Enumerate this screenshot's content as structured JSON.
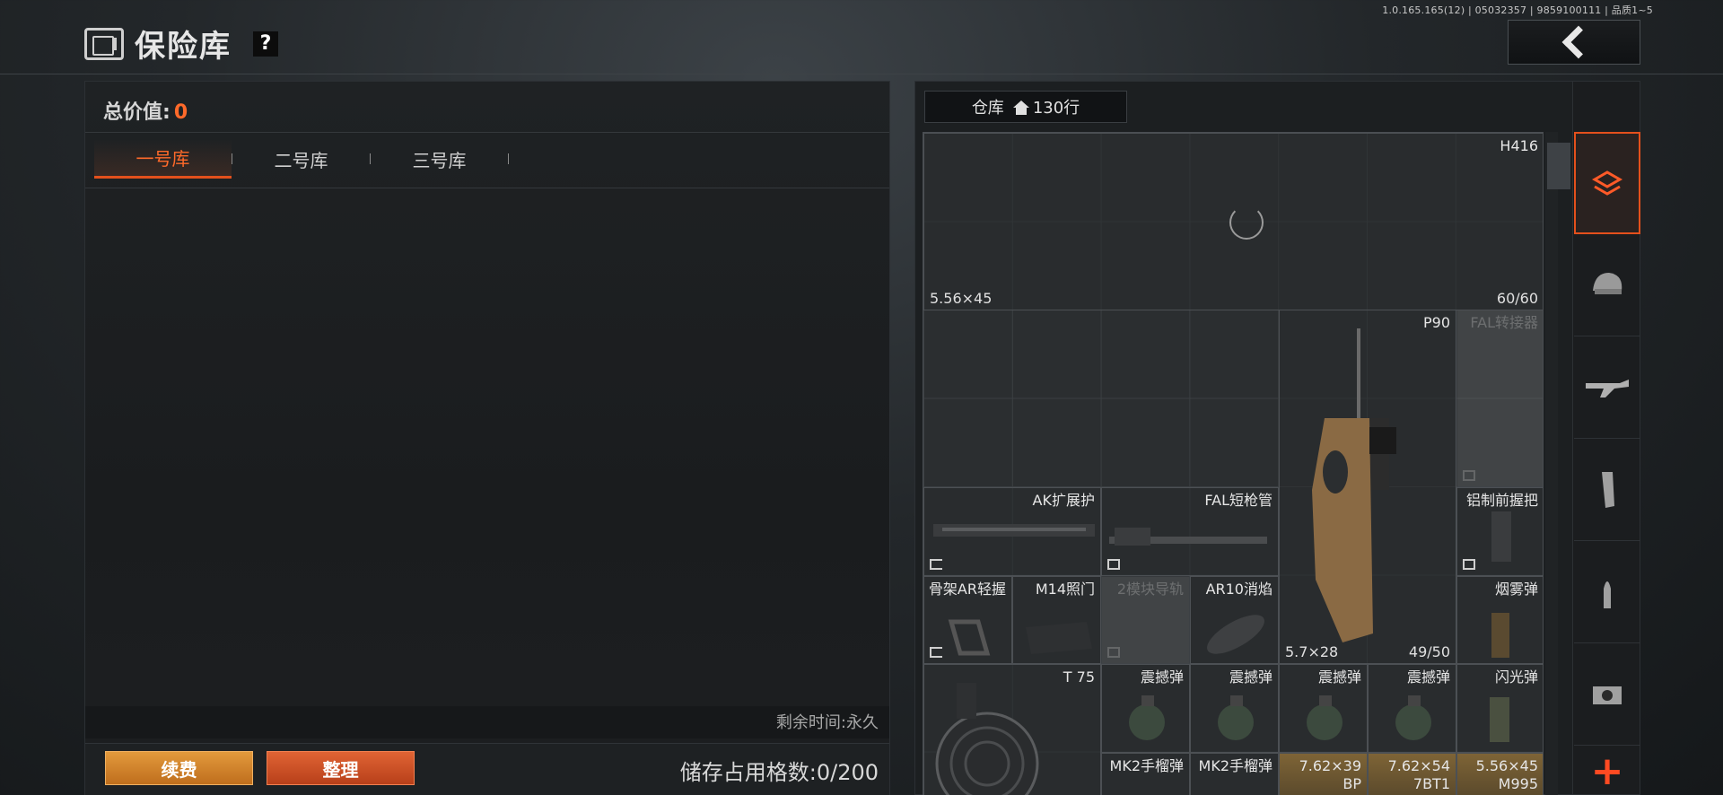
{
  "build_info": "1.0.165.165(12) | 05032357 | 9859100111 | 品质1~5",
  "header": {
    "title": "保险库",
    "help": "?"
  },
  "left": {
    "total_label": "总价值:",
    "total_value": "0",
    "tabs": [
      "一号库",
      "二号库",
      "三号库"
    ],
    "remaining": "剩余时间:永久",
    "renew_button": "续费",
    "sort_button": "整理",
    "storage": "储存占用格数:0/200"
  },
  "right": {
    "warehouse_label": "仓库",
    "warehouse_rows": "130行",
    "items": {
      "h416": {
        "name": "H416",
        "caliber": "5.56×45",
        "ammo": "60/60"
      },
      "p90": {
        "name": "P90",
        "caliber": "5.7×28",
        "ammo": "49/50"
      },
      "fal_adapter": {
        "name": "FAL转接器"
      },
      "ak_guard": {
        "name": "AK扩展护"
      },
      "fal_barrel": {
        "name": "FAL短枪管"
      },
      "al_grip": {
        "name": "铝制前握把"
      },
      "skeleton_grip": {
        "name": "骨架AR轻握"
      },
      "m14_sight": {
        "name": "M14照门"
      },
      "rail": {
        "name": "2模块导轨"
      },
      "ar10_sup": {
        "name": "AR10消焰"
      },
      "smoke": {
        "name": "烟雾弹"
      },
      "t75": {
        "name": "T 75"
      },
      "stun1": {
        "name": "震撼弹"
      },
      "stun2": {
        "name": "震撼弹"
      },
      "stun3": {
        "name": "震撼弹"
      },
      "stun4": {
        "name": "震撼弹"
      },
      "flash": {
        "name": "闪光弹"
      },
      "mk2a": {
        "name": "MK2手榴弹"
      },
      "mk2b": {
        "name": "MK2手榴弹"
      },
      "ammo1": {
        "name": "7.62×39",
        "sub": "BP"
      },
      "ammo2": {
        "name": "7.62×54",
        "sub": "7BT1"
      },
      "ammo3": {
        "name": "5.56×45",
        "sub": "M995"
      }
    }
  },
  "sidebar": {
    "icons": [
      "all-items-icon",
      "helmet-icon",
      "rifle-icon",
      "magazine-icon",
      "ammo-icon",
      "scope-icon"
    ],
    "add": "+"
  },
  "colors": {
    "accent": "#e4501c",
    "value": "#ff6a2a",
    "renew": "#d0842a",
    "sort": "#cf5428"
  }
}
